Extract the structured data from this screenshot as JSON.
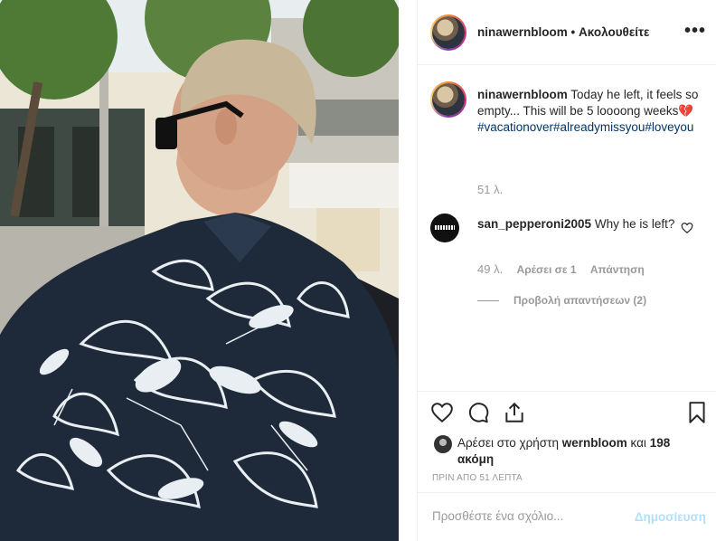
{
  "post": {
    "username": "ninawernbloom",
    "dot": "•",
    "follow_status": "Ακολουθείτε",
    "more_icon": "more-options-icon"
  },
  "caption": {
    "username": "ninawernbloom",
    "text": "Today he left, it feels so empty... This will be 5 loooong weeks💔",
    "hashtags": "#vacationover#alreadymissyou#loveyou",
    "time": "51 λ."
  },
  "comment": {
    "username": "san_pepperoni2005",
    "text": "Why he is left?",
    "time": "49 λ.",
    "likes": "Αρέσει σε 1",
    "reply": "Απάντηση",
    "view_replies": "Προβολή απαντήσεων (2)"
  },
  "actions": {
    "like_icon": "heart-icon",
    "comment_icon": "comment-icon",
    "share_icon": "share-icon",
    "save_icon": "bookmark-icon"
  },
  "liked_by": {
    "prefix": "Αρέσει στο χρήστη",
    "user": "wernbloom",
    "middle": "και",
    "others": "198 ακόμη"
  },
  "post_time": "ΠΡΙΝ ΑΠΟ 51 ΛΕΠΤΑ",
  "comment_box": {
    "placeholder": "Προσθέστε ένα σχόλιο...",
    "publish_label": "Δημοσίευση"
  },
  "colors": {
    "link": "#003569",
    "publish_disabled": "#b2dffc",
    "muted": "#999999"
  }
}
